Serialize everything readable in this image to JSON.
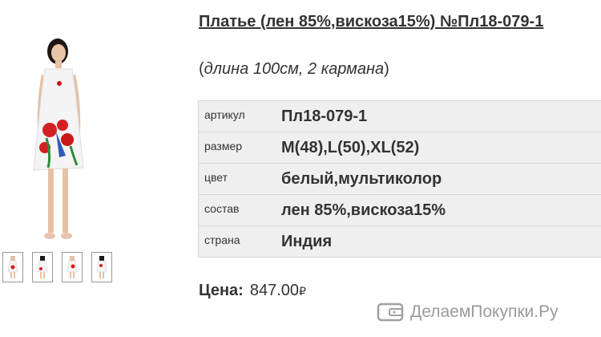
{
  "product": {
    "title": "Платье (лен 85%,вискоза15%) №Пл18-079-1",
    "subtitle_open": "(",
    "subtitle_text": "длина 100см, 2 кармана",
    "subtitle_close": ")"
  },
  "specs": [
    {
      "key": "артикул",
      "value": "Пл18-079-1"
    },
    {
      "key": "размер",
      "value": "M(48),L(50),XL(52)"
    },
    {
      "key": "цвет",
      "value": "белый,мультиколор"
    },
    {
      "key": "состав",
      "value": "лен 85%,вискоза15%"
    },
    {
      "key": "страна",
      "value": "Индия"
    }
  ],
  "price": {
    "label": "Цена:",
    "value": "847.00",
    "currency": "₽"
  },
  "watermark": {
    "text": "ДелаемПокупки.Ру"
  },
  "gallery": {
    "thumb_count": 4,
    "dress_color": "#f4f4f4",
    "accent_red": "#d42020",
    "accent_blue": "#2f5bb7"
  }
}
